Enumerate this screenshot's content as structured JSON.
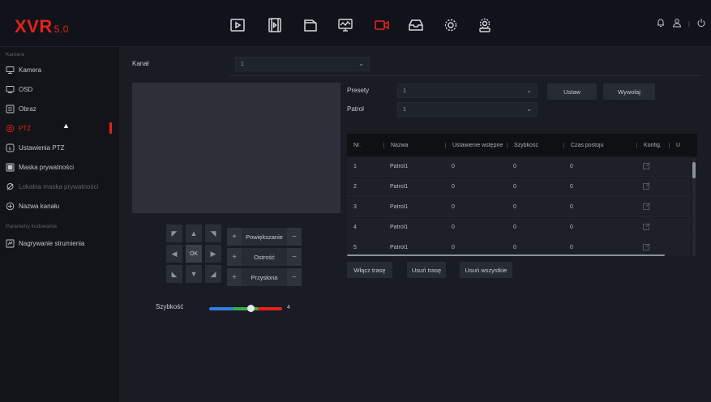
{
  "app": {
    "logo": "XVR",
    "version": "5.0"
  },
  "topbar": {
    "icons": [
      "playback-icon",
      "film-icon",
      "files-icon",
      "monitor-icon",
      "camera-icon",
      "backup-icon",
      "settings-icon",
      "system-settings-icon"
    ],
    "active_icon": "camera-icon",
    "right_icons": [
      "bell-icon",
      "user-icon",
      "power-icon"
    ],
    "accent": "#e2231a"
  },
  "sidebar": {
    "section1": "Kamera",
    "items": [
      {
        "label": "Kamera",
        "icon": "camera-icon",
        "state": "normal"
      },
      {
        "label": "OSD",
        "icon": "display-icon",
        "state": "normal"
      },
      {
        "label": "Obraz",
        "icon": "image-icon",
        "state": "normal"
      },
      {
        "label": "PTZ",
        "icon": "ptz-icon",
        "state": "active"
      },
      {
        "label": "Ustawienia PTZ",
        "icon": "ptz-settings-icon",
        "state": "normal"
      },
      {
        "label": "Maska prywatności",
        "icon": "mask-icon",
        "state": "normal"
      },
      {
        "label": "Lokalna maska prywatności",
        "icon": "local-mask-icon",
        "state": "disabled"
      },
      {
        "label": "Nazwa kanału",
        "icon": "channel-name-icon",
        "state": "normal"
      }
    ],
    "section2": "Parametry kodowania",
    "items2": [
      {
        "label": "Nagrywanie strumienia",
        "icon": "stream-icon",
        "state": "normal"
      }
    ]
  },
  "main": {
    "channel_label": "Kanał",
    "channel_value": "1",
    "presets_label": "Presety",
    "presets_value": "1",
    "patrol_label": "Patrol",
    "patrol_value": "1",
    "set_button": "Ustaw",
    "call_button": "Wywołaj",
    "ok_label": "OK",
    "zoom_label": "Powiększanie",
    "focus_label": "Ostrość",
    "iris_label": "Przysłona",
    "speed_label": "Szybkość",
    "speed_value": "4",
    "speed_fraction": 0.6,
    "enable_route": "Włącz trasę",
    "delete_route": "Usuń trasę",
    "delete_all": "Usuń wszystkie"
  },
  "table": {
    "headers": [
      "Nr.",
      "Nazwa",
      "Ustawienie wstępne",
      "Szybkość",
      "Czas postoju",
      "Konfig.",
      "U"
    ],
    "rows": [
      [
        "1",
        "Patrol1",
        "0",
        "0",
        "0"
      ],
      [
        "2",
        "Patrol1",
        "0",
        "0",
        "0"
      ],
      [
        "3",
        "Patrol1",
        "0",
        "0",
        "0"
      ],
      [
        "4",
        "Patrol1",
        "0",
        "0",
        "0"
      ],
      [
        "5",
        "Patrol1",
        "0",
        "0",
        "0"
      ]
    ]
  }
}
